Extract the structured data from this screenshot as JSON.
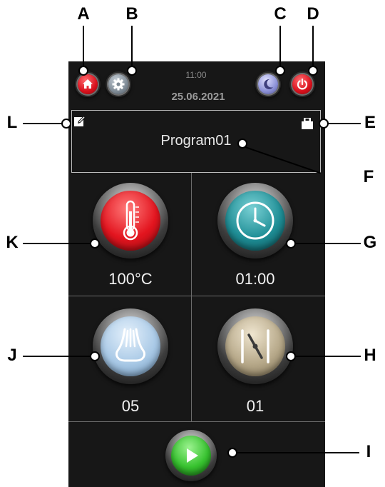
{
  "header": {
    "time": "11:00",
    "date": "25.06.2021"
  },
  "program": {
    "name": "Program01"
  },
  "tiles": {
    "temperature": "100°C",
    "time": "01:00",
    "steam": "05",
    "damper": "01"
  },
  "callouts": {
    "a": "A",
    "b": "B",
    "c": "C",
    "d": "D",
    "e": "E",
    "f": "F",
    "g": "G",
    "h": "H",
    "i": "I",
    "j": "J",
    "k": "K",
    "l": "L"
  },
  "icons": {
    "home": "home-icon",
    "settings": "gear-icon",
    "night": "moon-icon",
    "power": "power-icon",
    "edit": "edit-icon",
    "save": "save-icon",
    "temperature": "thermometer-icon",
    "clock": "clock-icon",
    "steam": "steam-icon",
    "damper": "damper-icon",
    "start": "play-icon"
  },
  "colors": {
    "screen": "#171717",
    "home": "#e0192b",
    "settings": "#8e9aa6",
    "night": "#8a8fd0",
    "power": "#e0192b",
    "temperature": "#e3151f",
    "clock": "#1f8e96",
    "steam": "#a9c9e6",
    "damper": "#b7a98a",
    "start": "#37c22f"
  }
}
